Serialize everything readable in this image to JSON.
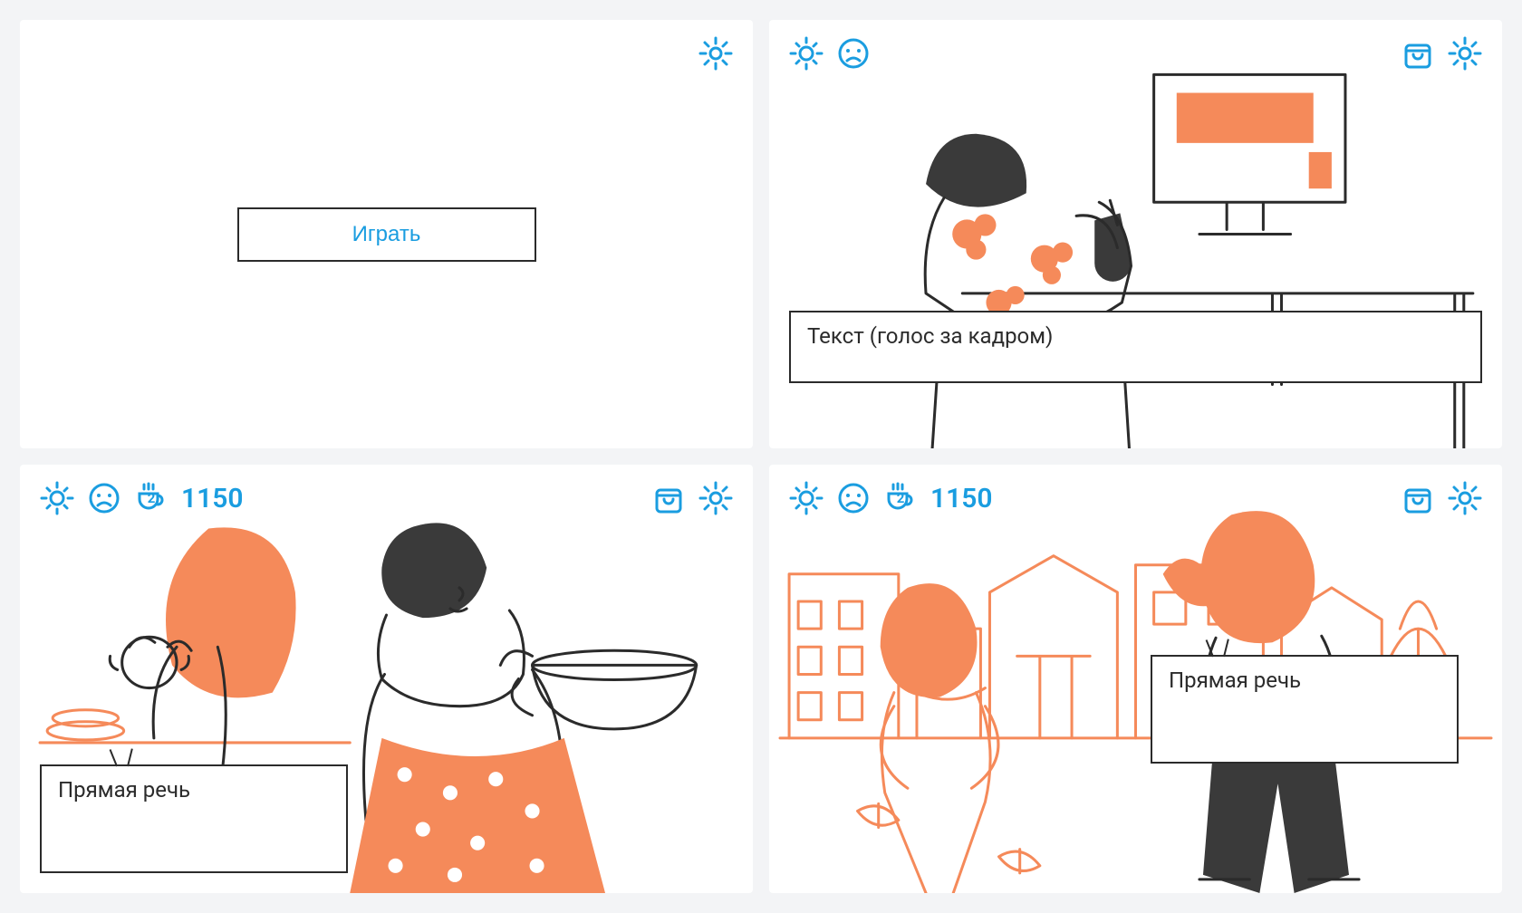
{
  "colors": {
    "accent": "#1a9de0",
    "ink": "#2b2b2b",
    "orange": "#f58a5a"
  },
  "icons": {
    "sun": "sun-icon",
    "mood": "sad-face-icon",
    "cup": "coffee-cup-icon",
    "shop": "shop-icon",
    "gear": "gear-icon"
  },
  "card1": {
    "play_label": "Играть"
  },
  "card2": {
    "caption": "Текст (голос за кадром)"
  },
  "card3": {
    "cup_badge": "2",
    "score": "1150",
    "caption": "Прямая речь"
  },
  "card4": {
    "cup_badge": "2",
    "score": "1150",
    "caption": "Прямая речь"
  }
}
